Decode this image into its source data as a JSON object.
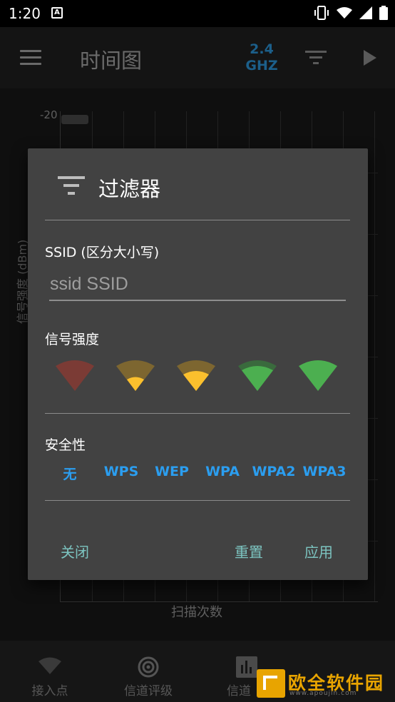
{
  "status_bar": {
    "time": "1:20",
    "notification_icon": "A"
  },
  "toolbar": {
    "title": "时间图",
    "band_line1": "2.4",
    "band_line2": "GHZ"
  },
  "chart": {
    "y_tick_top": "-20",
    "y_axis_label": "信号强度 (dBm)",
    "x_axis_label": "扫描次数"
  },
  "bottom_nav": {
    "items": [
      {
        "label": "接入点"
      },
      {
        "label": "信道评级"
      },
      {
        "label": "信道"
      }
    ]
  },
  "watermark": {
    "text": "欧全软件园",
    "sub": "www.apoujin.com"
  },
  "dialog": {
    "title": "过滤器",
    "ssid_label": "SSID (区分大小写)",
    "ssid_placeholder": "ssid SSID",
    "signal_label": "信号强度",
    "signal_levels": [
      {
        "name": "none",
        "color": "#7b3b35",
        "fill": 0
      },
      {
        "name": "low",
        "color": "#fbc02d",
        "fill": 1
      },
      {
        "name": "medium",
        "color": "#fbc02d",
        "fill": 2
      },
      {
        "name": "good",
        "color": "#4caf50",
        "fill": 3
      },
      {
        "name": "excellent",
        "color": "#4caf50",
        "fill": 4
      }
    ],
    "security_label": "安全性",
    "security_options": [
      "无",
      "WPS",
      "WEP",
      "WPA",
      "WPA2",
      "WPA3"
    ],
    "close_label": "关闭",
    "reset_label": "重置",
    "apply_label": "应用"
  },
  "colors": {
    "accent_blue": "#2b9ef0",
    "button_teal": "#7cc4c0",
    "dialog_bg": "#424242"
  }
}
